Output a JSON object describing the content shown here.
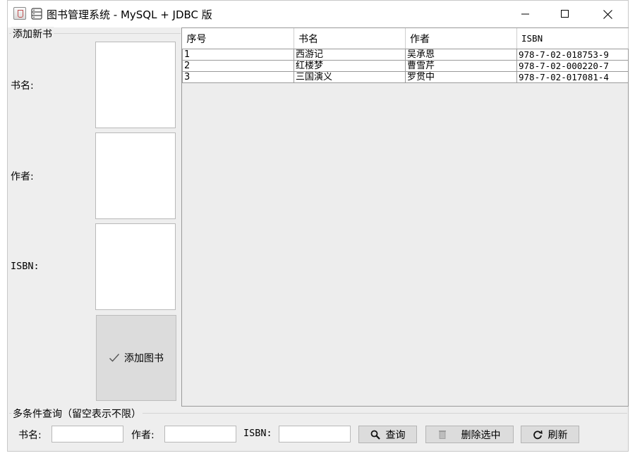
{
  "window": {
    "title": "图书管理系统 - MySQL + JDBC 版"
  },
  "add_panel": {
    "group_title": "添加新书",
    "labels": {
      "title": "书名:",
      "author": "作者:",
      "isbn": "ISBN:"
    },
    "add_button": "添加图书"
  },
  "table": {
    "headers": [
      "序号",
      "书名",
      "作者",
      "ISBN"
    ],
    "rows": [
      [
        "1",
        "西游记",
        "吴承恩",
        "978-7-02-018753-9"
      ],
      [
        "2",
        "红楼梦",
        "曹雪芹",
        "978-7-02-000220-7"
      ],
      [
        "3",
        "三国演义",
        "罗贯中",
        "978-7-02-017081-4"
      ]
    ]
  },
  "query": {
    "group_title": "多条件查询（留空表示不限）",
    "labels": {
      "title": "书名:",
      "author": "作者:",
      "isbn": "ISBN:"
    },
    "search_button": "查询",
    "delete_button": "删除选中",
    "refresh_button": "刷新"
  },
  "icons": {
    "app": "java-cup-icon",
    "title": "database-icon",
    "add": "checkmark-icon",
    "search": "magnifier-icon",
    "delete": "trash-icon",
    "refresh": "refresh-icon"
  },
  "colors": {
    "window_bg": "#eeeeee",
    "button_bg": "#dcdcdc",
    "field_bg": "#ffffff",
    "border": "#9a9a9a"
  }
}
